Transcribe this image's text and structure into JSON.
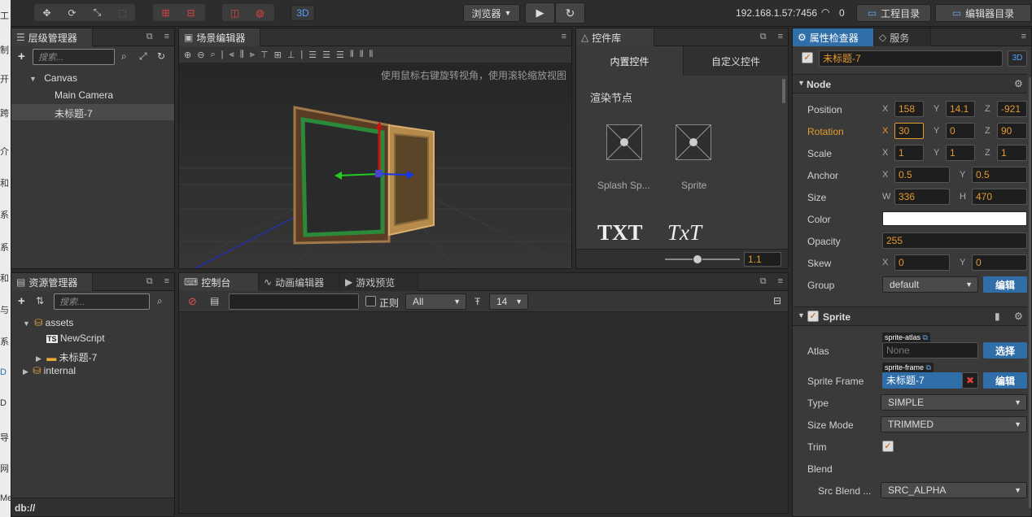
{
  "left_strip": [
    "工",
    "制",
    "开",
    "跨",
    "介",
    "和",
    "系",
    "系",
    "和",
    "与",
    "系",
    "D",
    "D",
    "导",
    "网",
    "Me"
  ],
  "toolbar": {
    "browser_label": "浏览器",
    "view3d_label": "3D",
    "ip": "192.168.1.57:7456",
    "wifi_count": "0",
    "project_dir": "工程目录",
    "editor_dir": "编辑器目录"
  },
  "hierarchy": {
    "title": "层级管理器",
    "search_placeholder": "搜索...",
    "items": [
      "Canvas",
      "Main Camera",
      "未标题-7"
    ]
  },
  "scene": {
    "title": "场景编辑器",
    "hint": "使用鼠标右键旋转视角，使用滚轮缩放视图"
  },
  "library": {
    "title": "控件库",
    "tab_builtin": "内置控件",
    "tab_custom": "自定义控件",
    "section": "渲染节点",
    "items": [
      "Splash Sp...",
      "Sprite"
    ],
    "text_icon1": "TXT",
    "text_icon2": "TxT",
    "zoom_value": "1.1",
    "zoom_fraction": 0.43
  },
  "assets": {
    "title": "资源管理器",
    "search_placeholder": "搜索...",
    "items": [
      "assets",
      "NewScript",
      "未标题-7",
      "internal"
    ],
    "status": "db://"
  },
  "console": {
    "tab_console": "控制台",
    "tab_anim": "动画编辑器",
    "tab_preview": "游戏预览",
    "regex_label": "正则",
    "filter_value": "All",
    "font_size": "14"
  },
  "inspector": {
    "tab_props": "属性检查器",
    "tab_service": "服务",
    "node_name": "未标题-7",
    "btn_3d": "3D",
    "node_section": "Node",
    "position": {
      "label": "Position",
      "x": "158",
      "y": "14.1",
      "z": "-921"
    },
    "rotation": {
      "label": "Rotation",
      "x": "30",
      "y": "0",
      "z": "90"
    },
    "scale": {
      "label": "Scale",
      "x": "1",
      "y": "1",
      "z": "1"
    },
    "anchor": {
      "label": "Anchor",
      "x": "0.5",
      "y": "0.5"
    },
    "size": {
      "label": "Size",
      "w": "336",
      "h": "470"
    },
    "color": {
      "label": "Color",
      "value": "#ffffff"
    },
    "opacity": {
      "label": "Opacity",
      "value": "255"
    },
    "skew": {
      "label": "Skew",
      "x": "0",
      "y": "0"
    },
    "group": {
      "label": "Group",
      "value": "default",
      "btn": "编辑"
    },
    "sprite_section": "Sprite",
    "atlas": {
      "label": "Atlas",
      "tag": "sprite-atlas",
      "value": "None",
      "btn": "选择"
    },
    "sprite_frame": {
      "label": "Sprite Frame",
      "tag": "sprite-frame",
      "value": "未标题-7",
      "btn": "编辑"
    },
    "type": {
      "label": "Type",
      "value": "SIMPLE"
    },
    "size_mode": {
      "label": "Size Mode",
      "value": "TRIMMED"
    },
    "trim": {
      "label": "Trim"
    },
    "blend": {
      "label": "Blend"
    },
    "src_blend": {
      "label": "Src Blend ...",
      "value": "SRC_ALPHA"
    },
    "axis_labels": {
      "x": "X",
      "y": "Y",
      "z": "Z",
      "w": "W",
      "h": "H"
    }
  },
  "colors": {
    "accent_blue": "#2f6ea8",
    "accent_orange": "#e39a2e",
    "panel_bg": "#3a3a3a"
  }
}
